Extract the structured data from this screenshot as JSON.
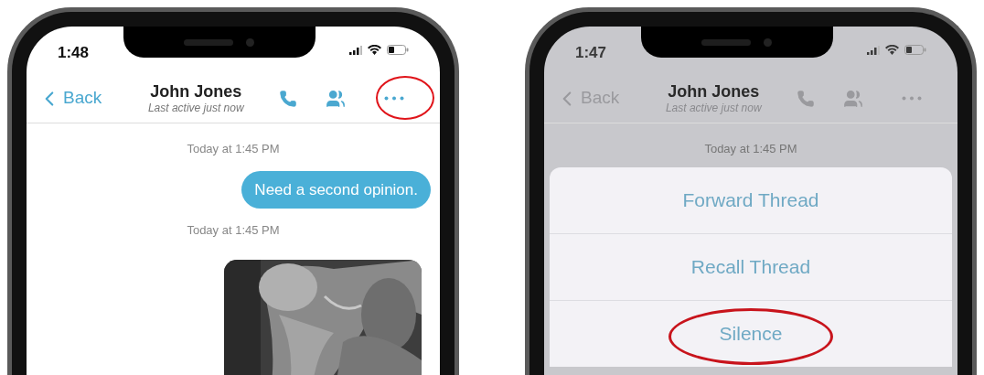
{
  "screens": [
    {
      "kind": "chat",
      "status_time": "1:48",
      "dimmed": false,
      "header": {
        "back": "Back",
        "title": "John Jones",
        "subtitle": "Last active just now",
        "more_circled": true
      },
      "messages": [
        {
          "kind": "timestamp",
          "text": "Today at 1:45 PM"
        },
        {
          "kind": "outgoing",
          "text": "Need a second opinion."
        },
        {
          "kind": "timestamp",
          "text": "Today at 1:45 PM"
        },
        {
          "kind": "picture"
        }
      ]
    },
    {
      "kind": "action_sheet",
      "status_time": "1:47",
      "dimmed": true,
      "header": {
        "back": "Back",
        "title": "John Jones",
        "subtitle": "Last active just now",
        "more_circled": false
      },
      "messages": [
        {
          "kind": "timestamp",
          "text": "Today at 1:45 PM"
        }
      ],
      "actions": [
        {
          "label": "Forward Thread",
          "circled": false
        },
        {
          "label": "Recall Thread",
          "circled": false
        },
        {
          "label": "Silence",
          "circled": true
        }
      ]
    }
  ]
}
